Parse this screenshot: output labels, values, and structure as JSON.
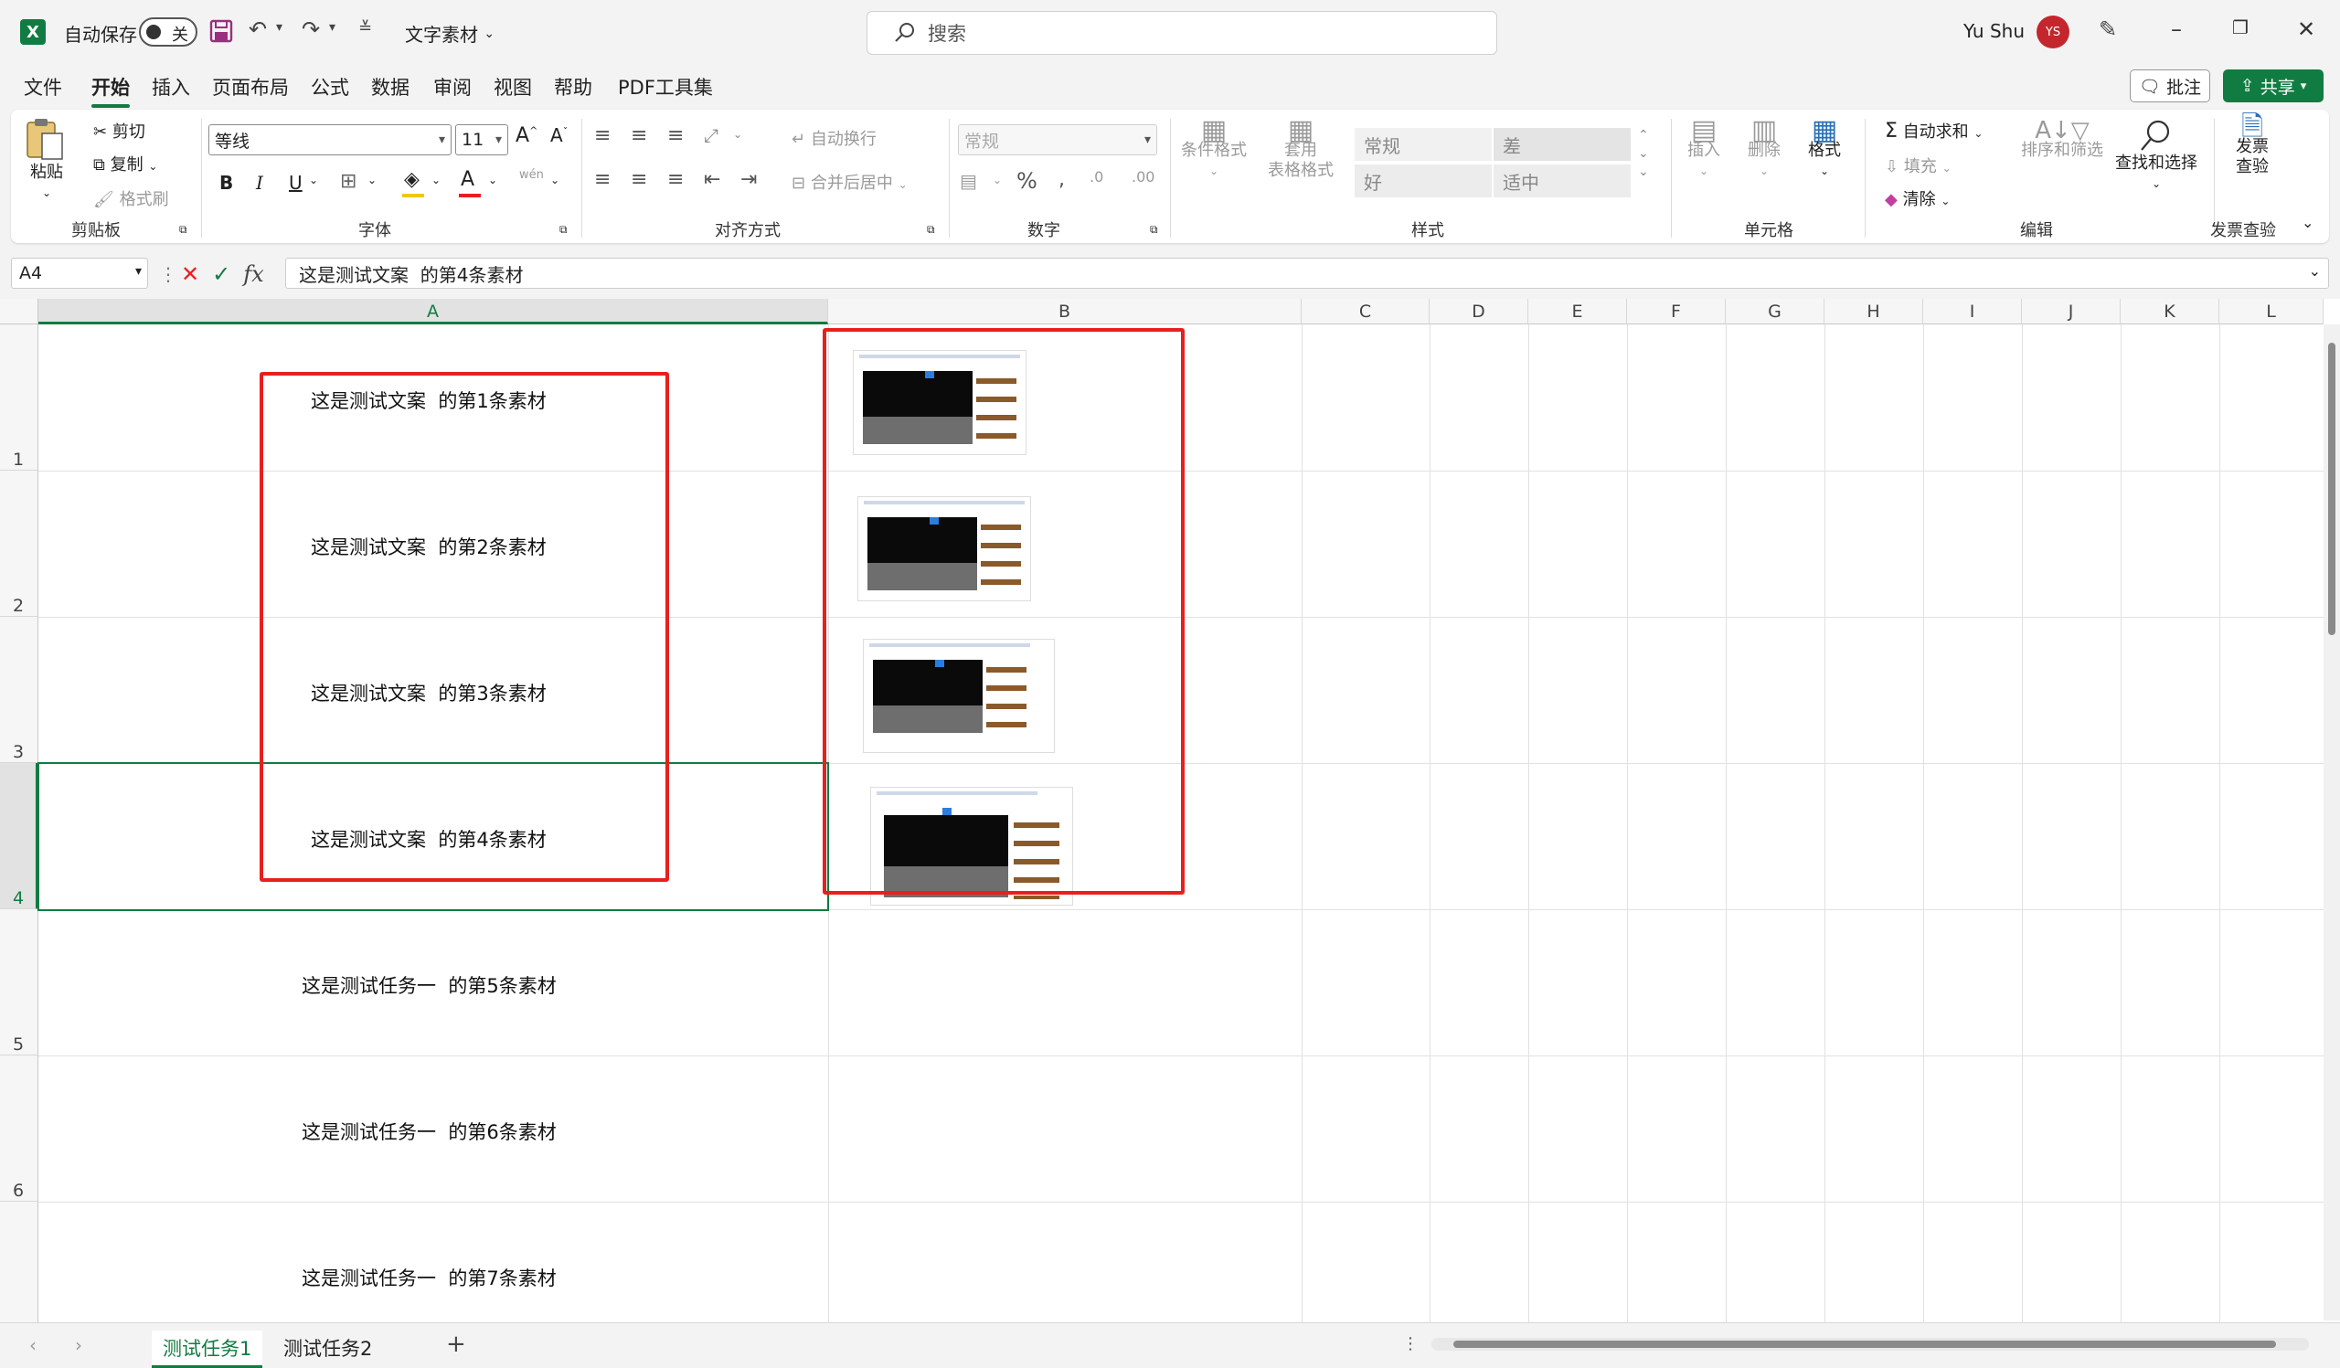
{
  "titlebar": {
    "autosave_label": "自动保存",
    "autosave_state": "关",
    "filename": "文字素材",
    "search_placeholder": "搜索",
    "username": "Yu Shu",
    "avatar_initials": "YS"
  },
  "menu": {
    "tabs": [
      "文件",
      "开始",
      "插入",
      "页面布局",
      "公式",
      "数据",
      "审阅",
      "视图",
      "帮助",
      "PDF工具集"
    ],
    "active": "开始",
    "comment_label": "批注",
    "share_label": "共享"
  },
  "ribbon": {
    "clipboard": {
      "paste": "粘贴",
      "cut": "剪切",
      "copy": "复制",
      "format_painter": "格式刷",
      "group": "剪贴板"
    },
    "font": {
      "name": "等线",
      "size": "11",
      "group": "字体",
      "phonetic": "wén"
    },
    "alignment": {
      "wrap": "自动换行",
      "merge": "合并后居中",
      "group": "对齐方式"
    },
    "number": {
      "format": "常规",
      "group": "数字"
    },
    "styles": {
      "conditional": "条件格式",
      "table_line1": "套用",
      "table_line2": "表格格式",
      "normal": "常规",
      "bad": "差",
      "good": "好",
      "neutral": "适中",
      "group": "样式"
    },
    "cells": {
      "insert": "插入",
      "delete": "删除",
      "format": "格式",
      "group": "单元格"
    },
    "editing": {
      "autosum": "自动求和",
      "fill": "填充",
      "clear": "清除",
      "sort": "排序和筛选",
      "find": "查找和选择",
      "group": "编辑"
    },
    "invoice": {
      "line1": "发票",
      "line2": "查验",
      "group": "发票查验"
    }
  },
  "formula_bar": {
    "name_box": "A4",
    "formula": "这是测试文案  的第4条素材"
  },
  "sheet": {
    "columns": [
      "A",
      "B",
      "C",
      "D",
      "E",
      "F",
      "G",
      "H",
      "I",
      "J",
      "K",
      "L"
    ],
    "rows": [
      "1",
      "2",
      "3",
      "4",
      "5",
      "6"
    ],
    "cells_a": [
      "这是测试文案  的第1条素材",
      "这是测试文案  的第2条素材",
      "这是测试文案  的第3条素材",
      "这是测试文案  的第4条素材",
      "这是测试任务一  的第5条素材",
      "这是测试任务一  的第6条素材",
      "这是测试任务一  的第7条素材"
    ]
  },
  "sheet_tabs": [
    "测试任务1",
    "测试任务2"
  ],
  "colors": {
    "excel_green": "#107c41",
    "highlight_red": "#e8201d",
    "avatar": "#c4262e"
  }
}
